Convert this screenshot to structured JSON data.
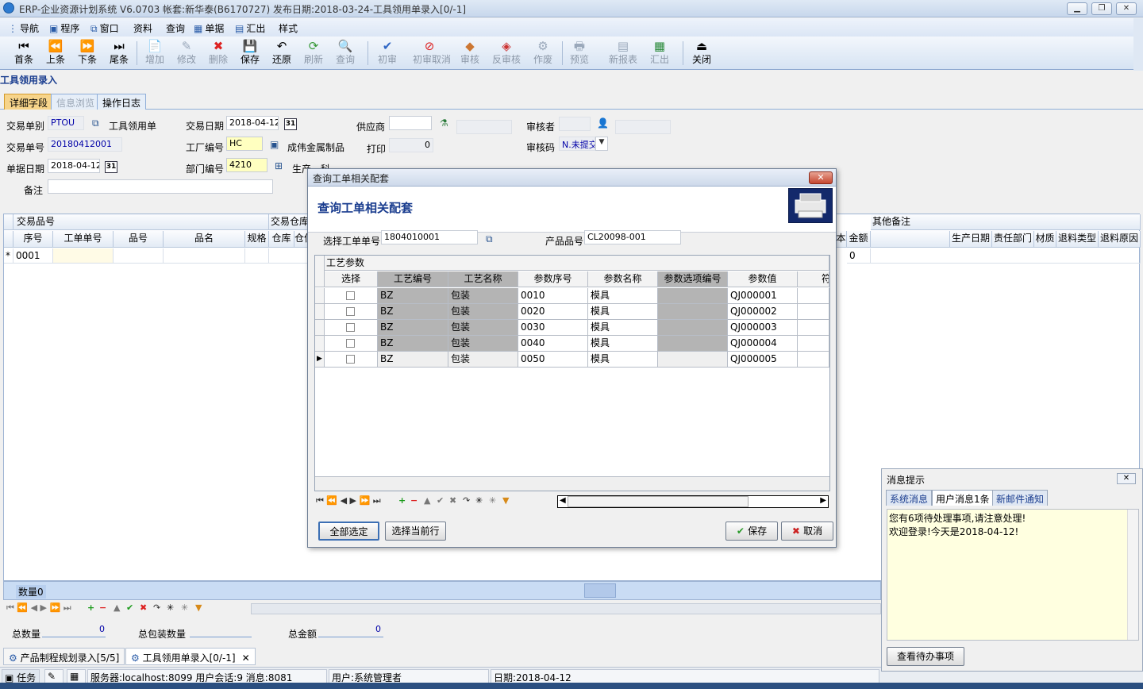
{
  "app": {
    "title": "ERP-企业资源计划系统 V6.0703  帐套:新华泰(B6170727)  发布日期:2018-03-24-工具领用单录入[0/-1]"
  },
  "menu": [
    "导航",
    "程序",
    "窗口",
    "资料",
    "查询",
    "单据",
    "汇出",
    "样式"
  ],
  "toolbar": [
    {
      "label": "首条",
      "icon": "first-record-icon",
      "enabled": true
    },
    {
      "label": "上条",
      "icon": "previous-record-icon",
      "enabled": true
    },
    {
      "label": "下条",
      "icon": "next-record-icon",
      "enabled": true
    },
    {
      "label": "尾条",
      "icon": "last-record-icon",
      "enabled": true
    },
    {
      "label": "增加",
      "icon": "add-icon",
      "enabled": false
    },
    {
      "label": "修改",
      "icon": "edit-icon",
      "enabled": false
    },
    {
      "label": "删除",
      "icon": "delete-icon",
      "enabled": false
    },
    {
      "label": "保存",
      "icon": "save-icon",
      "enabled": true
    },
    {
      "label": "还原",
      "icon": "undo-icon",
      "enabled": true
    },
    {
      "label": "刷新",
      "icon": "refresh-icon",
      "enabled": false
    },
    {
      "label": "查询",
      "icon": "query-icon",
      "enabled": false
    },
    {
      "label": "初审",
      "icon": "check-icon",
      "enabled": false
    },
    {
      "label": "初审取消",
      "icon": "uncheck-icon",
      "enabled": false
    },
    {
      "label": "审核",
      "icon": "approve-icon",
      "enabled": false
    },
    {
      "label": "反审核",
      "icon": "unapprove-icon",
      "enabled": false
    },
    {
      "label": "作废",
      "icon": "void-icon",
      "enabled": false
    },
    {
      "label": "预览",
      "icon": "preview-icon",
      "enabled": false
    },
    {
      "label": "新报表",
      "icon": "report-icon",
      "enabled": false
    },
    {
      "label": "汇出",
      "icon": "export-icon",
      "enabled": false
    },
    {
      "label": "关闭",
      "icon": "close-icon",
      "enabled": true
    }
  ],
  "page_title": "工具领用录入",
  "tabs": [
    {
      "label": "详细字段",
      "state": "active"
    },
    {
      "label": "信息浏览",
      "state": "disabled"
    },
    {
      "label": "操作日志",
      "state": "normal"
    }
  ],
  "form": {
    "trade_type_label": "交易单别",
    "trade_type": "PTOU",
    "trade_type_name": "工具领用单",
    "trade_no_label": "交易单号",
    "trade_no": "20180412001",
    "doc_date_label": "单据日期",
    "doc_date": "2018-04-12",
    "remark_label": "备注",
    "trade_date_label": "交易日期",
    "trade_date": "2018-04-12",
    "factory_label": "工厂编号",
    "factory": "HC",
    "factory_name": "成伟金属制品",
    "dept_label": "部门编号",
    "dept": "4210",
    "dept_name": "生产一科",
    "supplier_label": "供应商",
    "print_label": "打印",
    "print_count": "0",
    "reviewer_label": "审核者",
    "review_code_label": "审核码",
    "review_code": "N.未提交"
  },
  "grid": {
    "group_headers": [
      "交易品号",
      "交易仓库",
      "其他备注"
    ],
    "left_columns": [
      "序号",
      "工单单号",
      "品号",
      "品名",
      "规格",
      "仓库",
      "仓位"
    ],
    "right_columns": [
      "本",
      "金额"
    ],
    "far_right_columns": [
      "生产日期",
      "责任部门",
      "材质",
      "退料类型",
      "退料原因"
    ],
    "row": {
      "marker": "*",
      "seq": "0001",
      "amount": "0"
    },
    "qty_label": "数量",
    "qty_value": "0"
  },
  "totals": {
    "total_qty_label": "总数量",
    "total_qty": "0",
    "total_pack_label": "总包装数量",
    "total_amount_label": "总金额",
    "total_amount": "0"
  },
  "window_tabs": [
    "产品制程规划录入[5/5]",
    "工具领用单录入[0/-1]"
  ],
  "status": {
    "task": "任务",
    "server": "服务器:localhost:8099 用户会话:9 消息:8081",
    "user": "用户:系统管理者",
    "date": "日期:2018-04-12"
  },
  "modal": {
    "title": "查询工单相关配套",
    "header": "查询工单相关配套",
    "wo_label": "选择工单单号",
    "wo_value": "1804010001",
    "product_label": "产品品号",
    "product_value": "CL20098-001",
    "grid_title": "工艺参数",
    "columns": [
      "选择",
      "工艺编号",
      "工艺名称",
      "参数序号",
      "参数名称",
      "参数选项编号",
      "参数值",
      "符"
    ],
    "rows": [
      {
        "proc_no": "BZ",
        "proc_name": "包装",
        "seq": "0010",
        "name": "模具",
        "opt": "",
        "value": "QJ000001"
      },
      {
        "proc_no": "BZ",
        "proc_name": "包装",
        "seq": "0020",
        "name": "模具",
        "opt": "",
        "value": "QJ000002"
      },
      {
        "proc_no": "BZ",
        "proc_name": "包装",
        "seq": "0030",
        "name": "模具",
        "opt": "",
        "value": "QJ000003"
      },
      {
        "proc_no": "BZ",
        "proc_name": "包装",
        "seq": "0040",
        "name": "模具",
        "opt": "",
        "value": "QJ000004"
      },
      {
        "proc_no": "BZ",
        "proc_name": "包装",
        "seq": "0050",
        "name": "模具",
        "opt": "",
        "value": "QJ000005"
      }
    ],
    "btn_select_all": "全部选定",
    "btn_select_row": "选择当前行",
    "btn_save": "保存",
    "btn_cancel": "取消"
  },
  "messages": {
    "title": "消息提示",
    "tabs": [
      "系统消息",
      "用户消息1条",
      "新邮件通知"
    ],
    "lines": [
      "您有6项待处理事项,请注意处理!",
      "欢迎登录!今天是2018-04-12!"
    ],
    "button": "查看待办事项"
  }
}
